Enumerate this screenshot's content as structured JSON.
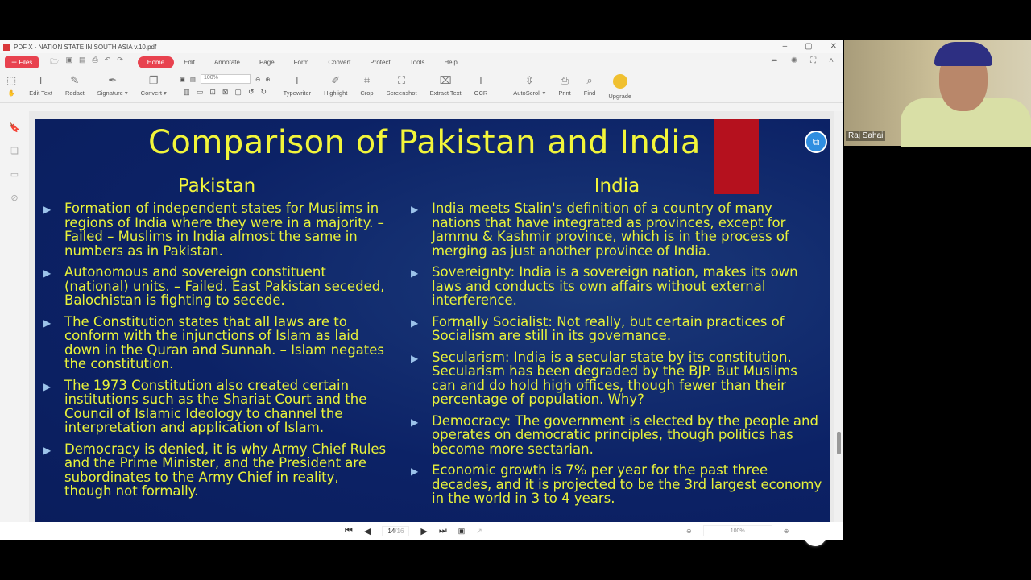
{
  "window": {
    "title": "PDF X - NATION STATE IN SOUTH ASIA v.10.pdf",
    "min": "–",
    "max": "▢",
    "close": "✕"
  },
  "menu": {
    "files": "☰ Files",
    "items": [
      "Home",
      "Edit",
      "Annotate",
      "Page",
      "Form",
      "Convert",
      "Protect",
      "Tools",
      "Help"
    ]
  },
  "toolbar": {
    "edit_text": "Edit Text",
    "redact": "Redact",
    "signature": "Signature ▾",
    "convert": "Convert ▾",
    "zoom": "100%",
    "typewriter": "Typewriter",
    "highlight": "Highlight",
    "crop": "Crop",
    "screenshot": "Screenshot",
    "extract_text": "Extract Text",
    "ocr": "OCR",
    "autoscroll": "AutoScroll ▾",
    "print": "Print",
    "find": "Find",
    "upgrade": "Upgrade"
  },
  "slide": {
    "title": "Comparison of Pakistan and India",
    "pakistan": {
      "heading": "Pakistan",
      "items": [
        "Formation of independent states for Muslims in regions of India where they were in a majority. – Failed – Muslims in India almost the same in numbers as in Pakistan.",
        "Autonomous and sovereign constituent (national) units. – Failed. East Pakistan seceded, Balochistan is fighting to secede.",
        "The Constitution states that all laws are to conform with the injunctions of Islam as laid down in the Quran and Sunnah. – Islam negates the constitution.",
        "The 1973 Constitution also created certain institutions such as the Shariat Court and the Council of Islamic Ideology to channel the interpretation and application of Islam.",
        "Democracy is denied, it is why Army Chief Rules and the Prime Minister, and the President are subordinates to the Army Chief in reality, though not formally."
      ]
    },
    "india": {
      "heading": "India",
      "items": [
        "India meets Stalin's definition of a country of many nations that have integrated as provinces, except for Jammu & Kashmir province, which is in the process of merging as just another province of India.",
        "Sovereignty: India is a sovereign nation, makes its own laws and conducts its own affairs without external interference.",
        "Formally Socialist: Not really, but certain practices of Socialism are still in its governance.",
        "Secularism: India is a secular state by its constitution. Secularism has been degraded by the BJP. But Muslims can and do hold high offices, though fewer than their percentage of population. Why?",
        "Democracy: The government is elected by the people and operates on democratic principles, though politics has become more sectarian.",
        "Economic growth is 7% per year for the past three decades, and it is projected to be the 3rd largest economy in the world in 3 to 4 years."
      ]
    }
  },
  "status": {
    "page": "14",
    "total": "/16",
    "zoom": "100%"
  },
  "webcam": {
    "name": "Raj Sahai"
  }
}
